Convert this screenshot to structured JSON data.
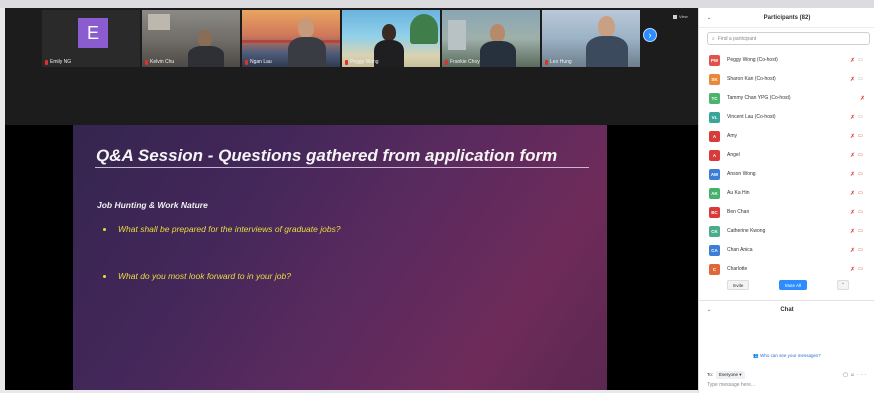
{
  "gallery": {
    "tiles": [
      {
        "name": "Emily NG",
        "avatar_letter": "E",
        "avatar_color": "#8b5ccf"
      },
      {
        "name": "Kelvin Chu"
      },
      {
        "name": "Ngan Lau"
      },
      {
        "name": "Peggy Wong"
      },
      {
        "name": "Frankie Choy"
      },
      {
        "name": "Leo Hung"
      }
    ],
    "view_label": "View",
    "next_icon": "chevron-right-icon"
  },
  "slide": {
    "title": "Q&A Session - Questions gathered from application form",
    "section": "Job Hunting & Work Nature",
    "bullets": [
      "What shall be prepared for the interviews of graduate jobs?",
      "What do you most look forward to in your job?"
    ]
  },
  "participants": {
    "header": "Participants (82)",
    "search_placeholder": "Find a participant",
    "rows": [
      {
        "initials": "PW",
        "name": "Peggy Wong (Co-host)",
        "color": "#e2524c"
      },
      {
        "initials": "SK",
        "name": "Sharon Kan (Co-host)",
        "color": "#e7883b"
      },
      {
        "initials": "TC",
        "name": "Tammy Chan YPG (Co-host)",
        "color": "#4bb36b"
      },
      {
        "initials": "VL",
        "name": "Vincent Lau (Co-host)",
        "color": "#3aa69a"
      },
      {
        "initials": "A",
        "name": "Amy",
        "color": "#d93b3b"
      },
      {
        "initials": "A",
        "name": "Angel",
        "color": "#d93b3b"
      },
      {
        "initials": "AW",
        "name": "Anson Wong",
        "color": "#3c7ed6"
      },
      {
        "initials": "AK",
        "name": "Au Ka Hin",
        "color": "#46b06d"
      },
      {
        "initials": "BC",
        "name": "Ben Chan",
        "color": "#d93b3b"
      },
      {
        "initials": "CK",
        "name": "Catherine Kwong",
        "color": "#47ad8a"
      },
      {
        "initials": "CA",
        "name": "Chan Anica",
        "color": "#3c7ed6"
      },
      {
        "initials": "C",
        "name": "Charlotte",
        "color": "#e0673a"
      }
    ],
    "invite_label": "Invite",
    "mute_all_label": "Mute All"
  },
  "chat": {
    "header": "Chat",
    "who_can_see": "Who can see your messages?",
    "to_label": "To:",
    "to_value": "Everyone",
    "placeholder": "Type message here..."
  }
}
